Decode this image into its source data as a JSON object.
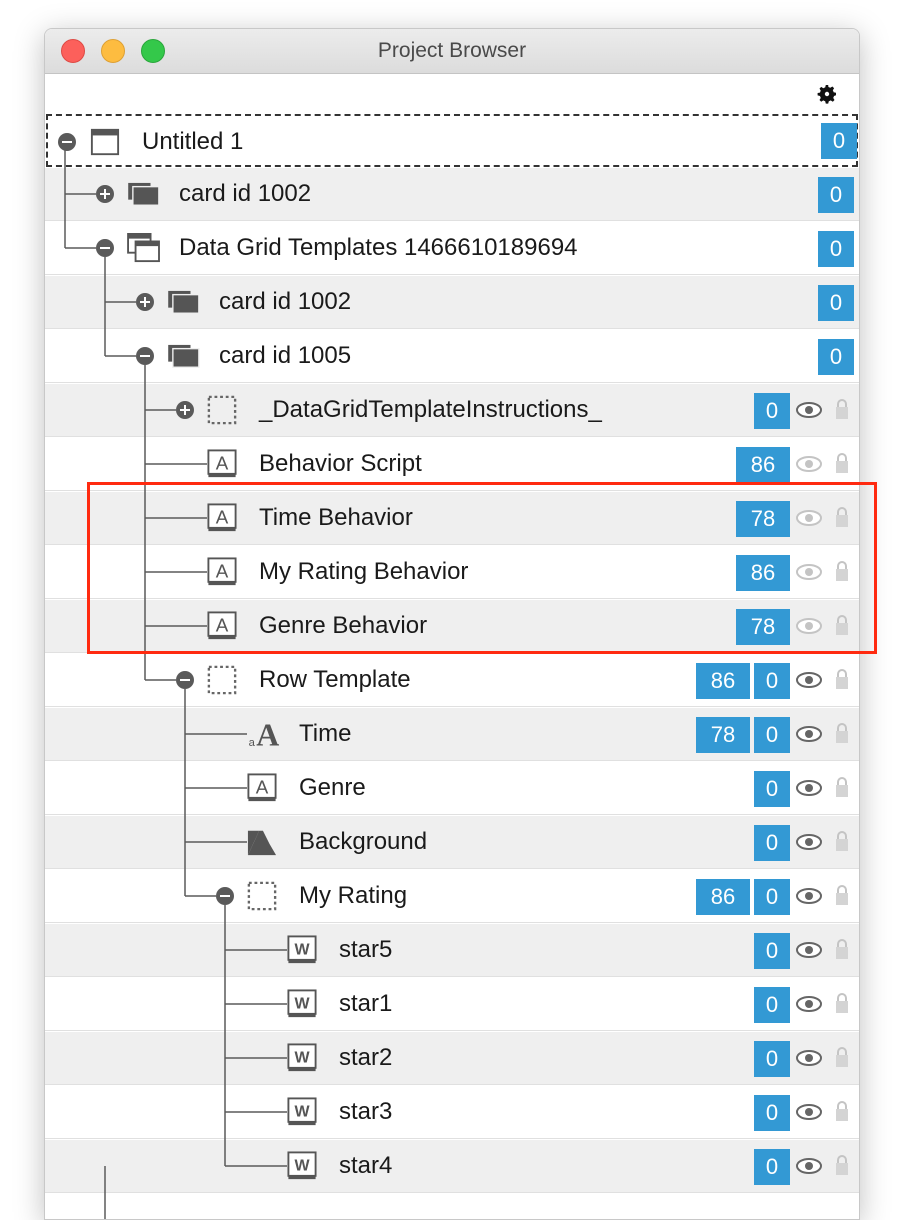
{
  "window": {
    "title": "Project Browser"
  },
  "colors": {
    "badge": "#3399d4",
    "highlight": "#ff2a10"
  },
  "rows": [
    {
      "label": "Untitled 1",
      "badges": [
        "0"
      ]
    },
    {
      "label": "card id 1002",
      "badges": [
        "0"
      ]
    },
    {
      "label": "Data Grid Templates 1466610189694",
      "badges": [
        "0"
      ]
    },
    {
      "label": "card id 1002",
      "badges": [
        "0"
      ]
    },
    {
      "label": "card id 1005",
      "badges": [
        "0"
      ]
    },
    {
      "label": "_DataGridTemplateInstructions_",
      "badges": [
        "0"
      ]
    },
    {
      "label": "Behavior Script",
      "badges": [
        "86"
      ]
    },
    {
      "label": "Time Behavior",
      "badges": [
        "78"
      ]
    },
    {
      "label": "My Rating Behavior",
      "badges": [
        "86"
      ]
    },
    {
      "label": "Genre Behavior",
      "badges": [
        "78"
      ]
    },
    {
      "label": "Row Template",
      "badges": [
        "86",
        "0"
      ]
    },
    {
      "label": "Time",
      "badges": [
        "78",
        "0"
      ]
    },
    {
      "label": "Genre",
      "badges": [
        "0"
      ]
    },
    {
      "label": "Background",
      "badges": [
        "0"
      ]
    },
    {
      "label": "My Rating",
      "badges": [
        "86",
        "0"
      ]
    },
    {
      "label": "star5",
      "badges": [
        "0"
      ]
    },
    {
      "label": "star1",
      "badges": [
        "0"
      ]
    },
    {
      "label": "star2",
      "badges": [
        "0"
      ]
    },
    {
      "label": "star3",
      "badges": [
        "0"
      ]
    },
    {
      "label": "star4",
      "badges": [
        "0"
      ]
    }
  ],
  "icons": [
    "gear-icon",
    "stack-icon",
    "card-icon",
    "group-icon",
    "field-icon",
    "label-icon",
    "graphic-icon",
    "widget-icon",
    "eye-icon",
    "lock-icon"
  ]
}
